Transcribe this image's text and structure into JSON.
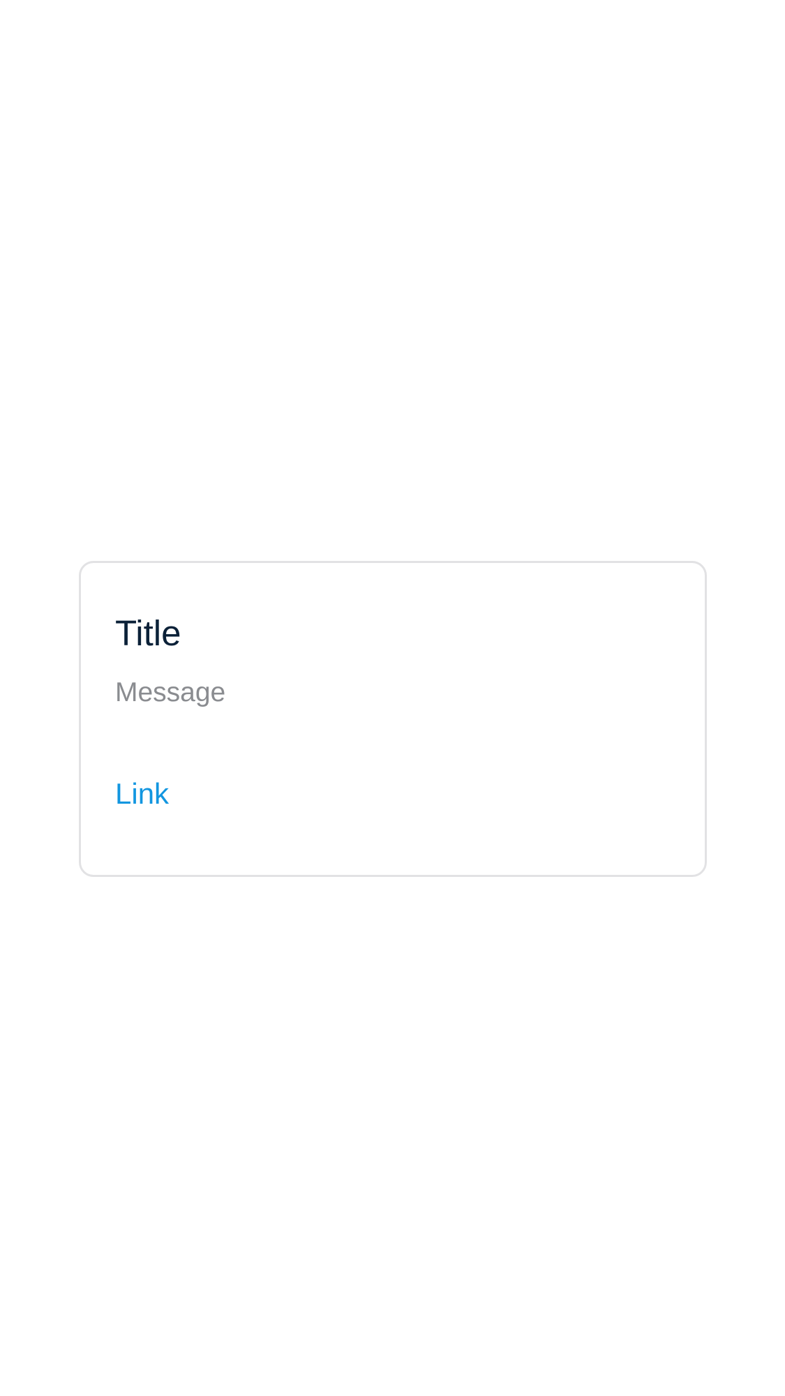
{
  "card": {
    "title": "Title",
    "message": "Message",
    "link_label": "Link"
  },
  "colors": {
    "background": "#ffffff",
    "card_border": "#e2e2e4",
    "title": "#0b2138",
    "message": "#8a8c90",
    "link": "#1296e0"
  }
}
